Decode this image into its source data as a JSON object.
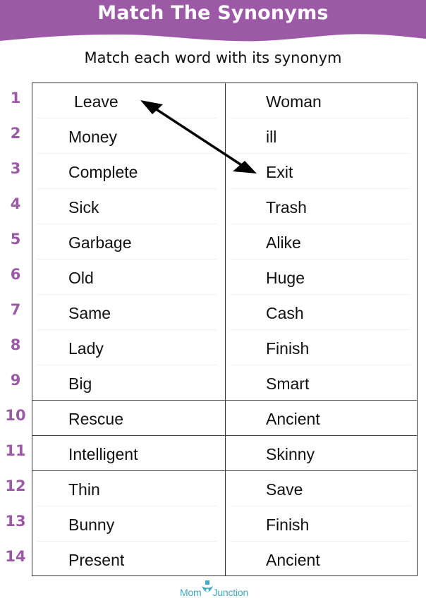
{
  "header": {
    "title": "Match The Synonyms",
    "subtitle": "Match each word with its synonym",
    "banner_color": "#9b59a6"
  },
  "rows": [
    {
      "number": "1",
      "left": "Leave",
      "right": "Woman"
    },
    {
      "number": "2",
      "left": "Money",
      "right": "ill"
    },
    {
      "number": "3",
      "left": "Complete",
      "right": "Exit"
    },
    {
      "number": "4",
      "left": "Sick",
      "right": "Trash"
    },
    {
      "number": "5",
      "left": "Garbage",
      "right": "Alike"
    },
    {
      "number": "6",
      "left": "Old",
      "right": "Huge"
    },
    {
      "number": "7",
      "left": "Same",
      "right": "Cash"
    },
    {
      "number": "8",
      "left": "Lady",
      "right": "Finish"
    },
    {
      "number": "9",
      "left": "Big",
      "right": "Smart"
    },
    {
      "number": "10",
      "left": "Rescue",
      "right": "Ancient"
    },
    {
      "number": "11",
      "left": "Intelligent",
      "right": "Skinny"
    },
    {
      "number": "12",
      "left": "Thin",
      "right": "Save"
    },
    {
      "number": "13",
      "left": "Bunny",
      "right": "Finish"
    },
    {
      "number": "14",
      "left": "Present",
      "right": "Ancient"
    }
  ],
  "example_match": {
    "from": "Leave",
    "to": "Exit",
    "icon": "double-arrow-icon"
  },
  "footer": {
    "logo_left": "Mom",
    "logo_right": "Junction",
    "logo_icon": "momjunction-logo-icon",
    "logo_color": "#3fa9c6"
  }
}
